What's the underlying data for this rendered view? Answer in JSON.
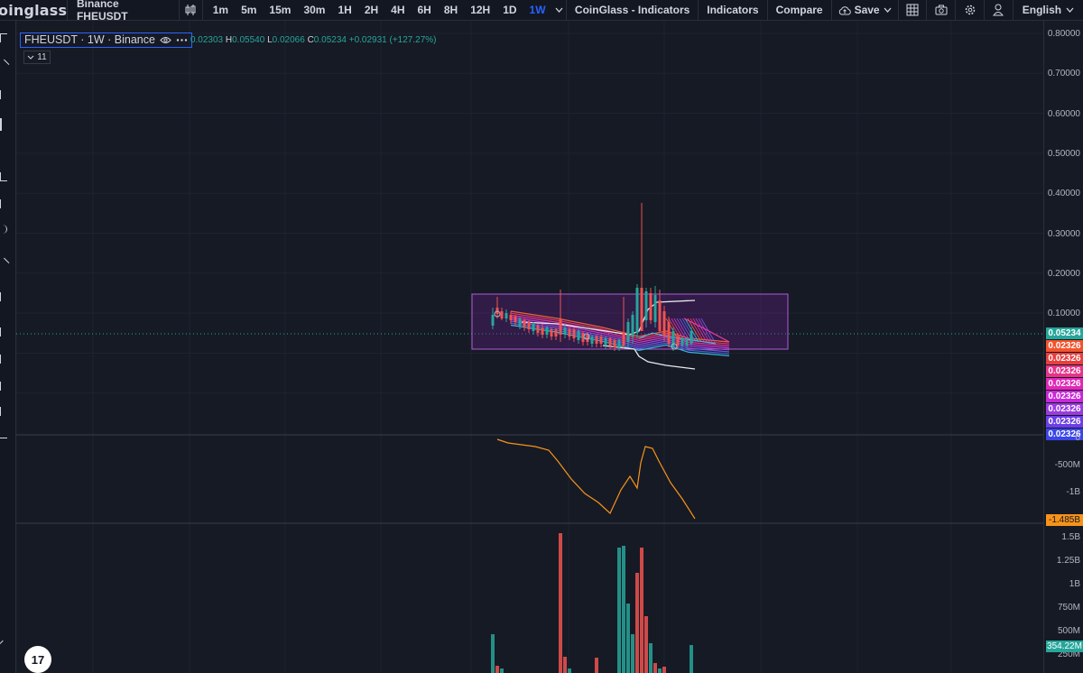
{
  "brand": {
    "logo_text": "oinglass"
  },
  "toolbar": {
    "symbol": "Binance FHEUSDT",
    "timeframes": [
      "1m",
      "5m",
      "15m",
      "30m",
      "1H",
      "2H",
      "4H",
      "6H",
      "8H",
      "12H",
      "1D",
      "1W"
    ],
    "active_timeframe": "1W",
    "coinglass_indicators": "CoinGlass - Indicators",
    "indicators": "Indicators",
    "compare": "Compare",
    "save": "Save",
    "language": "English"
  },
  "legend": {
    "title": "FHEUSDT · 1W · Binance",
    "open": "0.02303",
    "high_label": "H",
    "high": "0.05540",
    "low_label": "L",
    "low": "0.02066",
    "close_label": "C",
    "close": "0.05234",
    "change": "+0.02931 (+127.27%)",
    "indicator_count": "11"
  },
  "price_axis": {
    "labels": [
      "0.80000",
      "0.70000",
      "0.60000",
      "0.50000",
      "0.40000",
      "0.30000",
      "0.20000",
      "0.10000"
    ],
    "current_price": "0.05234",
    "level_tags": [
      "0.02326",
      "0.02326",
      "0.02326",
      "0.02326",
      "0.02326",
      "0.02326",
      "0.02326",
      "0.02326"
    ],
    "level_colors": [
      "#f2542d",
      "#e83f3f",
      "#e8338a",
      "#e028b8",
      "#c828d8",
      "#9a3be0",
      "#6c3ee6",
      "#3a46e8"
    ]
  },
  "cvd_axis": {
    "labels": [
      "0",
      "-500M",
      "-1B"
    ],
    "current": "-1.485B"
  },
  "volume_axis": {
    "labels": [
      "1.5B",
      "1.25B",
      "1B",
      "750M",
      "500M",
      "250M"
    ],
    "current": "354.22M"
  },
  "colors": {
    "up": "#26a69a",
    "down": "#ef5350",
    "accent": "#2962ff",
    "cvd_line": "#f7931a",
    "box": "#7b1fa2"
  },
  "chart_data": {
    "type": "candlestick",
    "interval": "1W",
    "price_ylim": [
      0,
      0.8
    ],
    "cvd_ylim": [
      -1.5,
      0
    ],
    "volume_ylim": [
      0,
      1.6
    ]
  }
}
